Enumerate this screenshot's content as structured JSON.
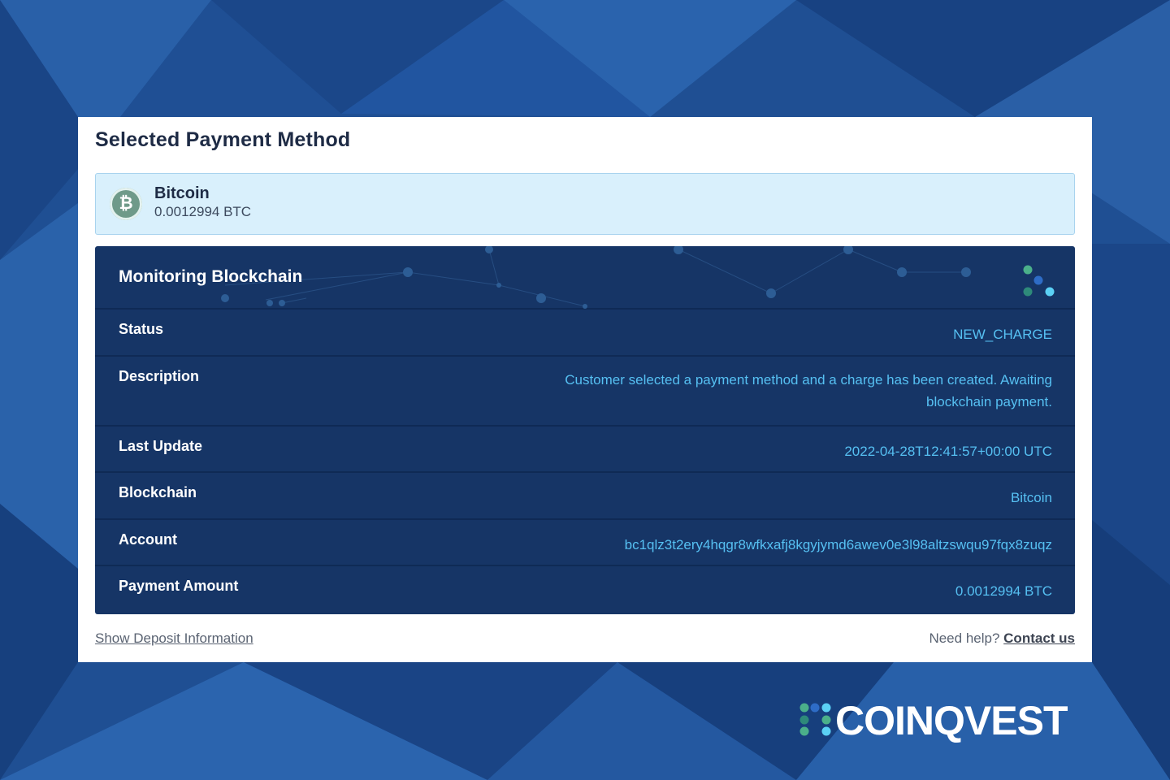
{
  "colors": {
    "background": "#1f4f93",
    "panel": "#163566",
    "accent": "#56c0f2",
    "method_box": "#d9f0fc"
  },
  "card": {
    "title": "Selected Payment Method"
  },
  "payment_method": {
    "icon": "bitcoin-icon",
    "name": "Bitcoin",
    "amount": "0.0012994 BTC"
  },
  "monitor": {
    "title": "Monitoring Blockchain",
    "spinner_icon": "loading-dots-icon",
    "rows": [
      {
        "label": "Status",
        "value": "NEW_CHARGE"
      },
      {
        "label": "Description",
        "value": "Customer selected a payment method and a charge has been created. Awaiting blockchain payment."
      },
      {
        "label": "Last Update",
        "value": "2022-04-28T12:41:57+00:00 UTC"
      },
      {
        "label": "Blockchain",
        "value": "Bitcoin"
      },
      {
        "label": "Account",
        "value": "bc1qlz3t2ery4hqgr8wfkxafj8kgyjymd6awev0e3l98altzswqu97fqx8zuqz"
      },
      {
        "label": "Payment Amount",
        "value": "0.0012994 BTC"
      }
    ]
  },
  "footer": {
    "deposit_link": "Show Deposit Information",
    "help_text": "Need help?",
    "contact_link": "Contact us"
  },
  "brand": {
    "name": "COINQVEST",
    "logo_icon": "coinqvest-dots-icon"
  }
}
